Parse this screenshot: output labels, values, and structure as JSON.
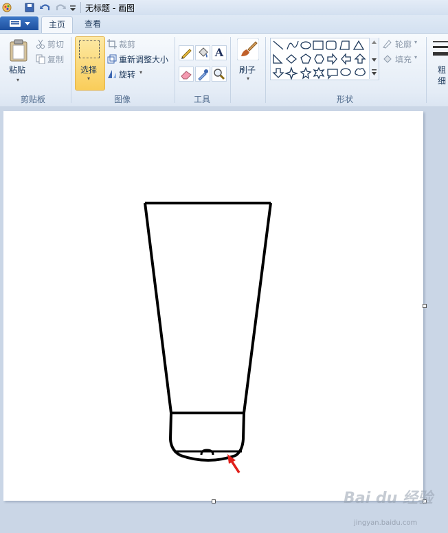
{
  "window": {
    "title": "无标题 - 画图"
  },
  "tabs": [
    {
      "label": "主页"
    },
    {
      "label": "查看"
    }
  ],
  "clipboard": {
    "paste": "粘贴",
    "cut": "剪切",
    "copy": "复制",
    "group_label": "剪贴板"
  },
  "image": {
    "select": "选择",
    "crop": "裁剪",
    "resize": "重新调整大小",
    "rotate": "旋转",
    "group_label": "图像"
  },
  "tools": {
    "group_label": "工具"
  },
  "brushes": {
    "label": "刷子"
  },
  "shapes": {
    "outline": "轮廓",
    "fill": "填充",
    "group_label": "形状"
  },
  "size": {
    "label_line1": "粗",
    "label_line2": "细"
  },
  "watermark": {
    "brand": "Bai du 经验",
    "url": "jingyan.baidu.com"
  },
  "colors": {
    "accent_select": "#f9cd5a",
    "arrow": "#e0201b",
    "ink": "#000000"
  }
}
